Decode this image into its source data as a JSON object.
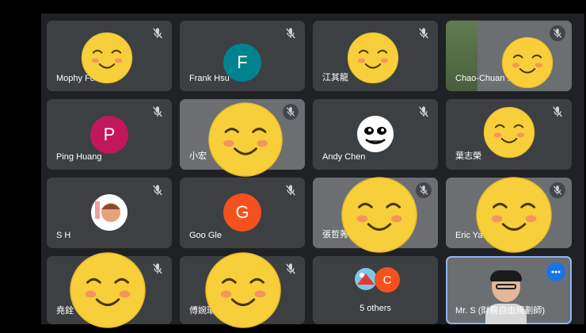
{
  "tiles": [
    {
      "name": "Mophy Fo ... y"
    },
    {
      "name": "Frank Hsu",
      "initial": "F"
    },
    {
      "name": "江其龍"
    },
    {
      "name": "Chao-Chuan ... as"
    },
    {
      "name": "Ping Huang",
      "initial": "P"
    },
    {
      "name": "小宏"
    },
    {
      "name": "Andy Chen"
    },
    {
      "name": "葉志榮"
    },
    {
      "name": "S H"
    },
    {
      "name": "Goo Gle",
      "initial": "G"
    },
    {
      "name": "張哲莠"
    },
    {
      "name": "Eric Ya ... ons"
    },
    {
      "name": "堯銓"
    },
    {
      "name": "傅婉瑜"
    },
    {
      "name": "5 others",
      "initial": "C"
    },
    {
      "name": "Mr. S (財務自由規劃師)"
    }
  ],
  "colors": {
    "frank": "#00838f",
    "ping": "#c2185b",
    "goo": "#f4511e",
    "others": "#f4511e",
    "highlight": "#1a73e8"
  },
  "icons": {
    "mute": "mic-off-icon",
    "more": "more-options-icon"
  }
}
